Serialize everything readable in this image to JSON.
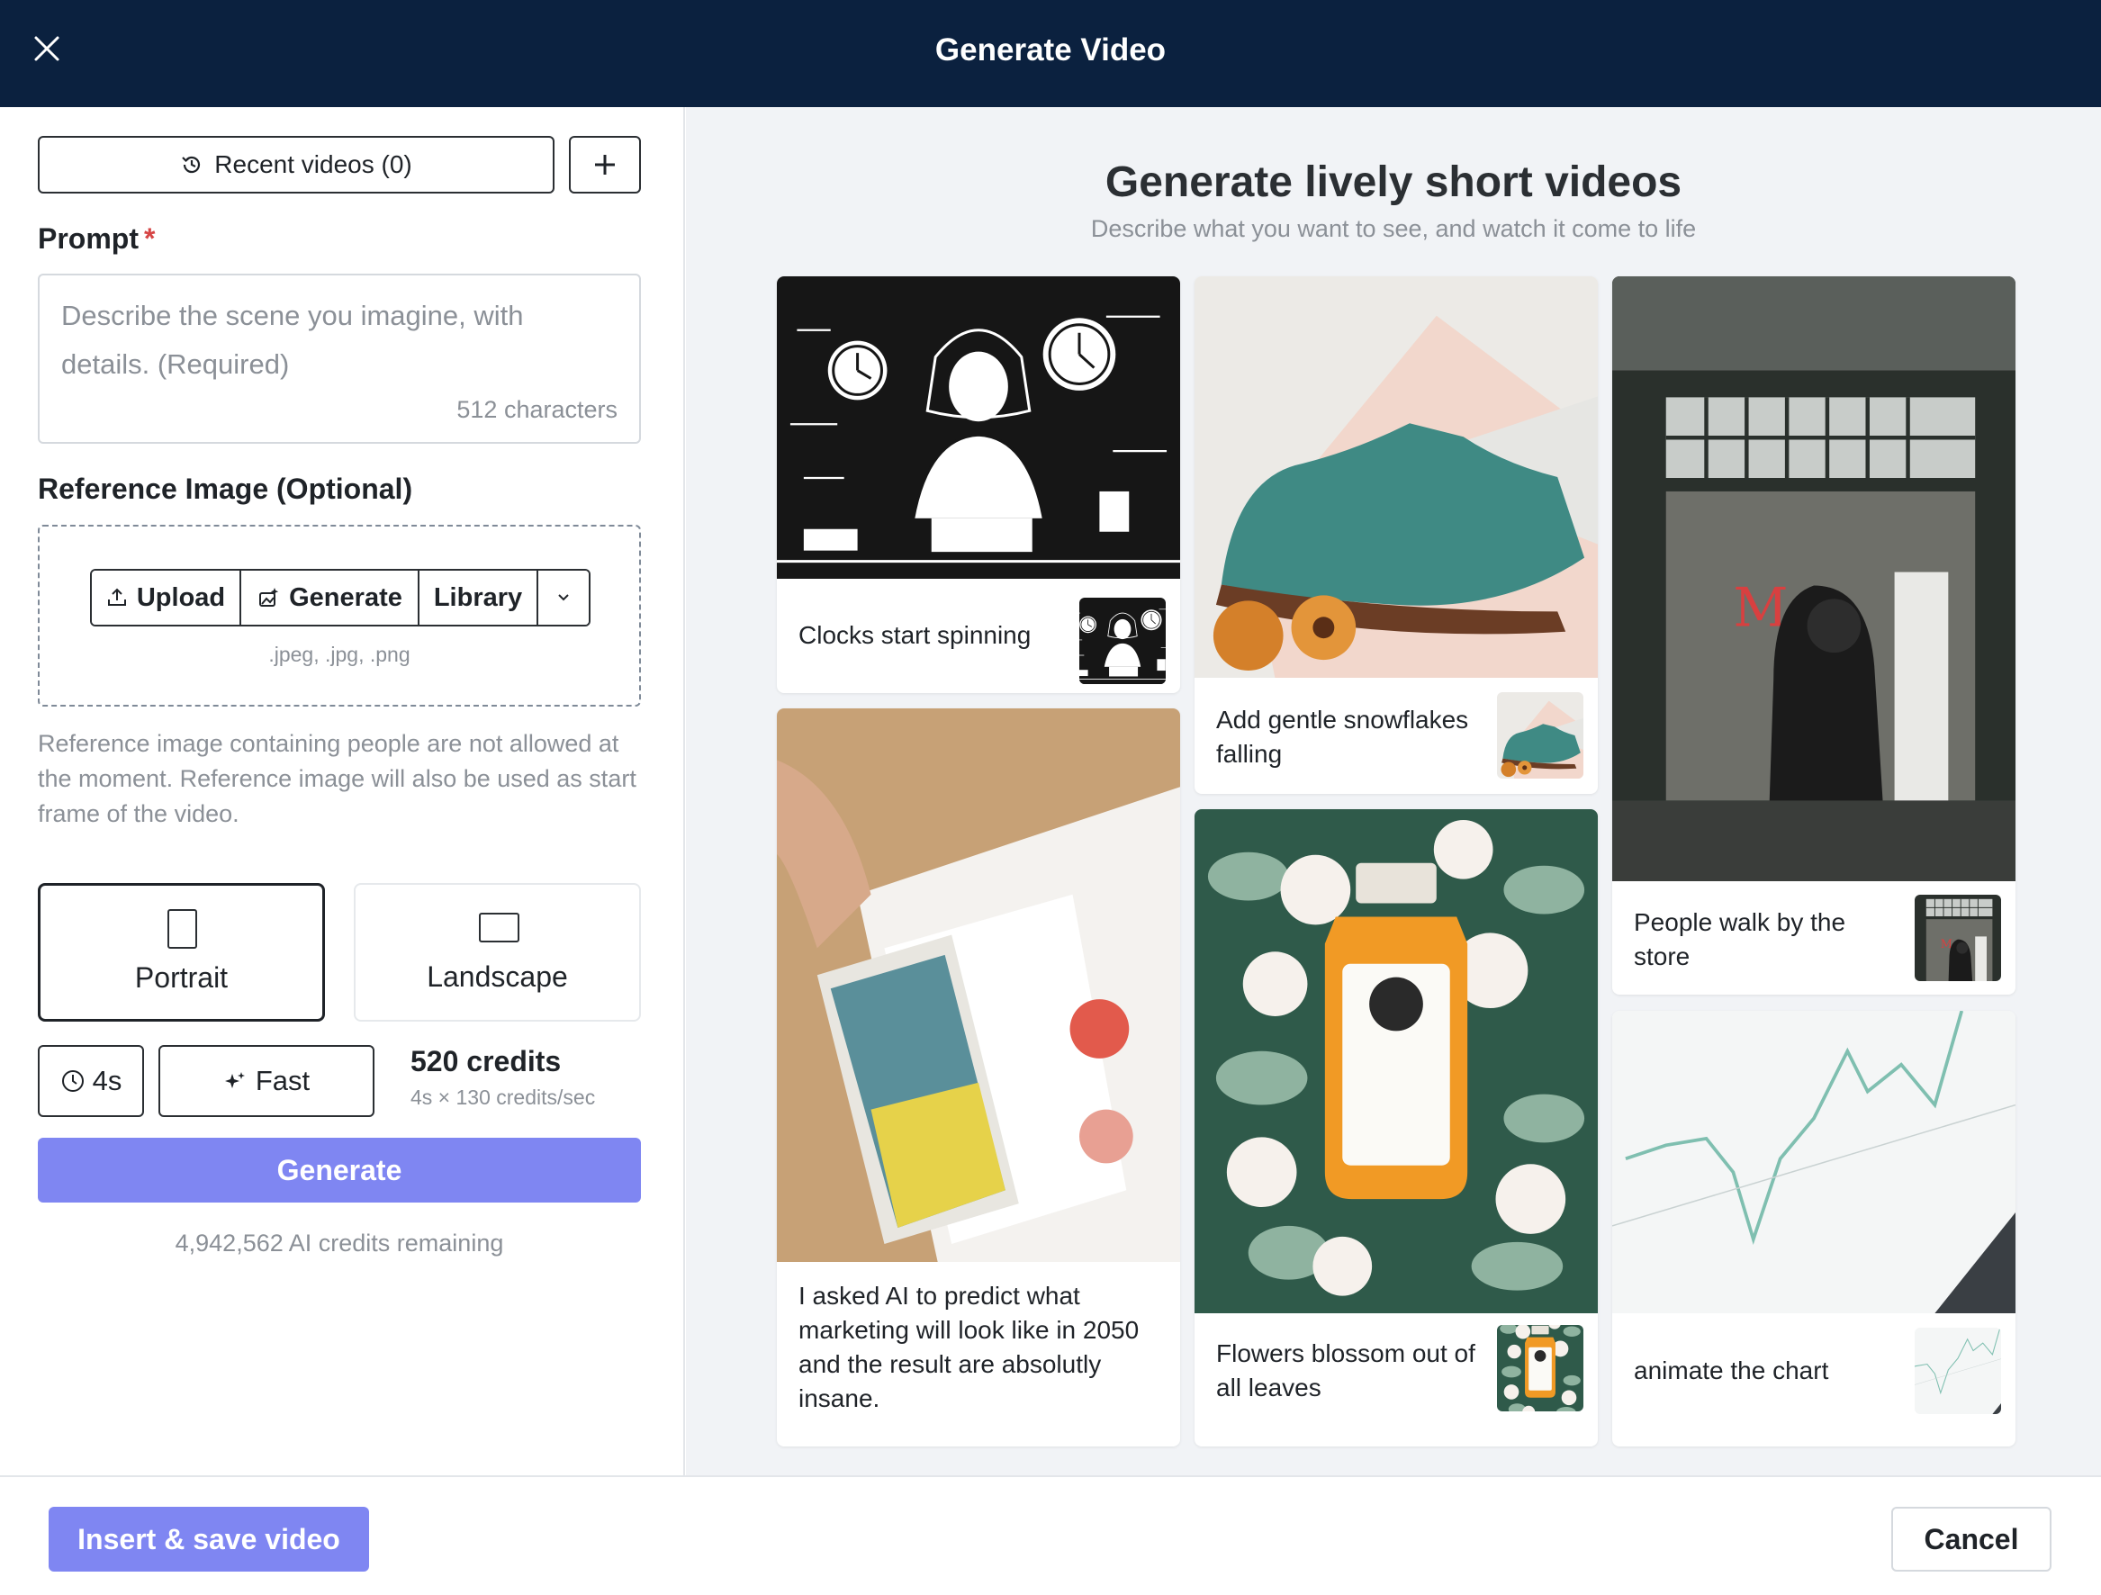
{
  "dialog": {
    "title": "Generate Video"
  },
  "left": {
    "recent_label": "Recent videos (0)",
    "prompt_label": "Prompt",
    "required_mark": "*",
    "prompt_placeholder": "Describe the scene you imagine, with details. (Required)",
    "prompt_count": "512 characters",
    "reference_label": "Reference Image (Optional)",
    "upload_label": "Upload",
    "generate_label": "Generate",
    "library_label": "Library",
    "formats": ".jpeg, .jpg, .png",
    "note": "Reference image containing people are not allowed at the moment. Reference image will also be used as start frame of the video.",
    "portrait_label": "Portrait",
    "landscape_label": "Landscape",
    "duration_label": "4s",
    "speed_label": "Fast",
    "credits_total": "520 credits",
    "credits_detail": "4s × 130 credits/sec",
    "generate_button": "Generate",
    "remaining": "4,942,562 AI credits remaining"
  },
  "right": {
    "title": "Generate lively short videos",
    "subtitle": "Describe what you want to see, and watch it come to life",
    "examples": [
      {
        "caption": "Clocks start spinning",
        "icon": "illustration-woman-clocks"
      },
      {
        "caption": "Add gentle snowflakes falling",
        "icon": "photo-green-shoe"
      },
      {
        "caption": "People walk by the store",
        "icon": "photo-storefront"
      },
      {
        "caption": "I asked AI to predict what marketing will look like in 2050 and the result are absolutly insane.",
        "icon": "photo-tablet-charts"
      },
      {
        "caption": "Flowers blossom out of all leaves",
        "icon": "photo-juice-flowers"
      },
      {
        "caption": "animate the chart",
        "icon": "photo-line-chart"
      }
    ]
  },
  "footer": {
    "insert_label": "Insert & save video",
    "cancel_label": "Cancel"
  },
  "colors": {
    "header_bg": "#0b213f",
    "accent": "#7f86f2",
    "panel_bg": "#f1f3f6",
    "required": "#d64545"
  }
}
